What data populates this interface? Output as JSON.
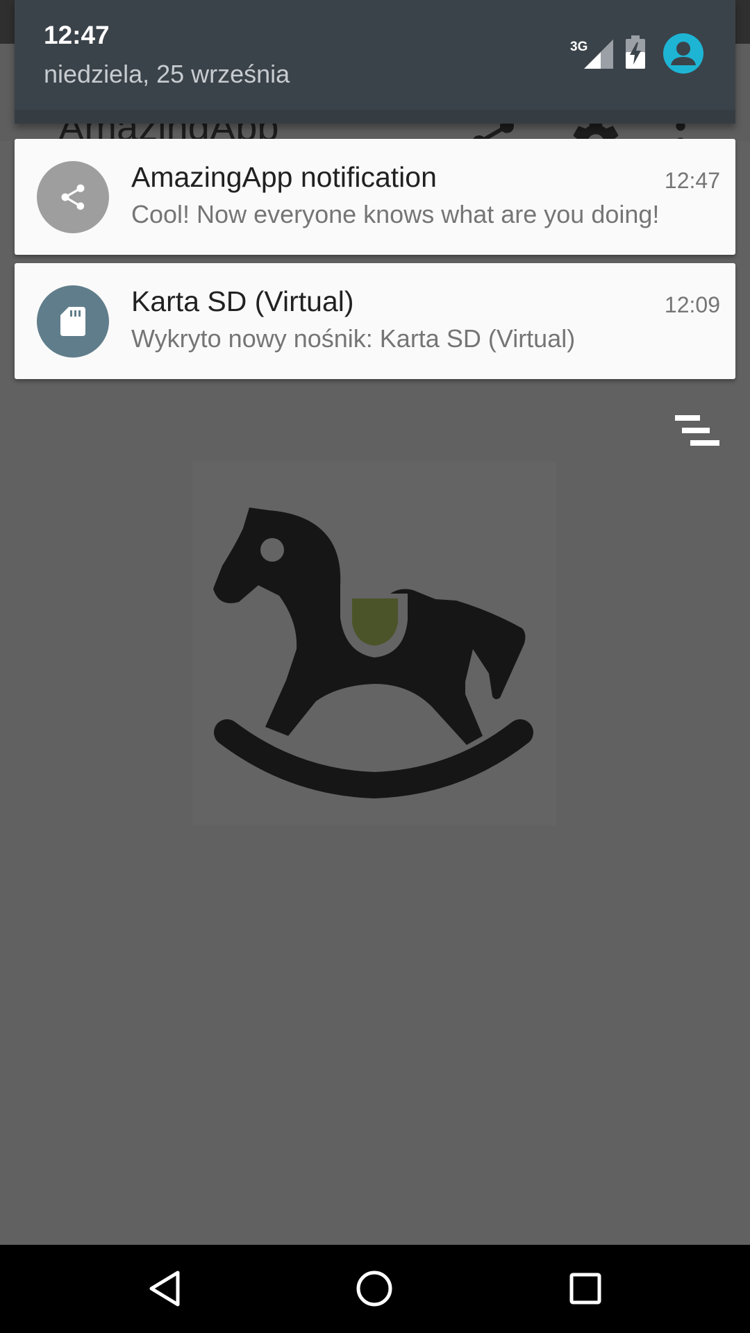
{
  "app": {
    "title": "AmazingApp",
    "actions": {
      "share_icon": "share-icon",
      "settings_icon": "gear-icon",
      "overflow_icon": "overflow-menu-icon"
    },
    "image": "rocking-horse-image"
  },
  "quick_settings": {
    "time": "12:47",
    "date": "niedziela, 25 września",
    "signal_label": "3G",
    "icons": [
      "signal-3g-icon",
      "battery-charging-icon",
      "user-avatar-icon"
    ],
    "avatar_color": "#1eb5d5",
    "background_color": "#3b434a"
  },
  "notifications": [
    {
      "title": "AmazingApp notification",
      "text": "Cool! Now everyone knows what are you doing!",
      "time": "12:47",
      "icon": "share-icon",
      "icon_bg": "#9e9e9e"
    },
    {
      "title": "Karta SD (Virtual)",
      "text": "Wykryto nowy nośnik: Karta SD (Virtual)",
      "time": "12:09",
      "icon": "sd-card-icon",
      "icon_bg": "#607d8b"
    }
  ],
  "clear_all_icon": "clear-all-icon",
  "navigation": {
    "back": "back-icon",
    "home": "home-icon",
    "recents": "recents-icon"
  }
}
